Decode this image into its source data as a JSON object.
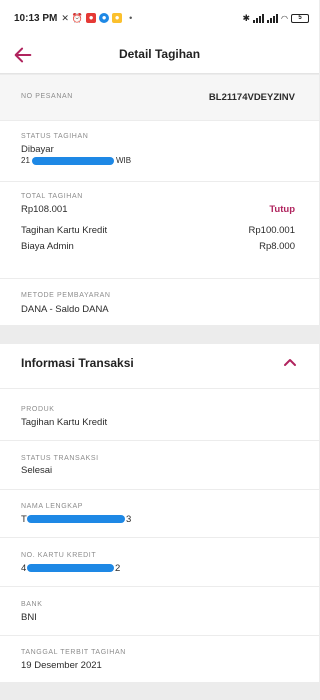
{
  "status_bar": {
    "time": "10:13 PM",
    "icons": [
      "bell-off-icon",
      "alarm-icon",
      "app-icon-red",
      "chat-icon-blue",
      "note-icon-yellow",
      "dot"
    ],
    "right_icons": [
      "bluetooth-icon",
      "signal-icon",
      "signal-icon",
      "wifi-icon",
      "battery-icon"
    ],
    "battery": "5"
  },
  "header": {
    "title": "Detail Tagihan"
  },
  "order": {
    "label": "NO PESANAN",
    "value": "BL21174VDEYZINV"
  },
  "status": {
    "label": "STATUS TAGIHAN",
    "value": "Dibayar",
    "date_prefix": "21",
    "date_suffix": "WIB"
  },
  "total": {
    "label": "TOTAL TAGIHAN",
    "value": "Rp108.001",
    "toggle": "Tutup",
    "items": [
      {
        "name": "Tagihan Kartu Kredit",
        "amount": "Rp100.001"
      },
      {
        "name": "Biaya Admin",
        "amount": "Rp8.000"
      }
    ]
  },
  "payment": {
    "label": "METODE PEMBAYARAN",
    "value": "DANA - Saldo DANA"
  },
  "transaction": {
    "title": "Informasi Transaksi",
    "fields": [
      {
        "label": "PRODUK",
        "value": "Tagihan Kartu Kredit"
      },
      {
        "label": "STATUS TRANSAKSI",
        "value": "Selesai"
      },
      {
        "label": "NAMA LENGKAP",
        "value_prefix": "T",
        "value_suffix": "3"
      },
      {
        "label": "NO. KARTU KREDIT",
        "value_prefix": "4",
        "value_suffix": "2"
      },
      {
        "label": "BANK",
        "value": "BNI"
      },
      {
        "label": "TANGGAL TERBIT TAGIHAN",
        "value": "19 Desember 2021"
      }
    ]
  },
  "colors": {
    "accent": "#b0245e",
    "redaction": "#1e88e5",
    "background": "#ececec"
  }
}
